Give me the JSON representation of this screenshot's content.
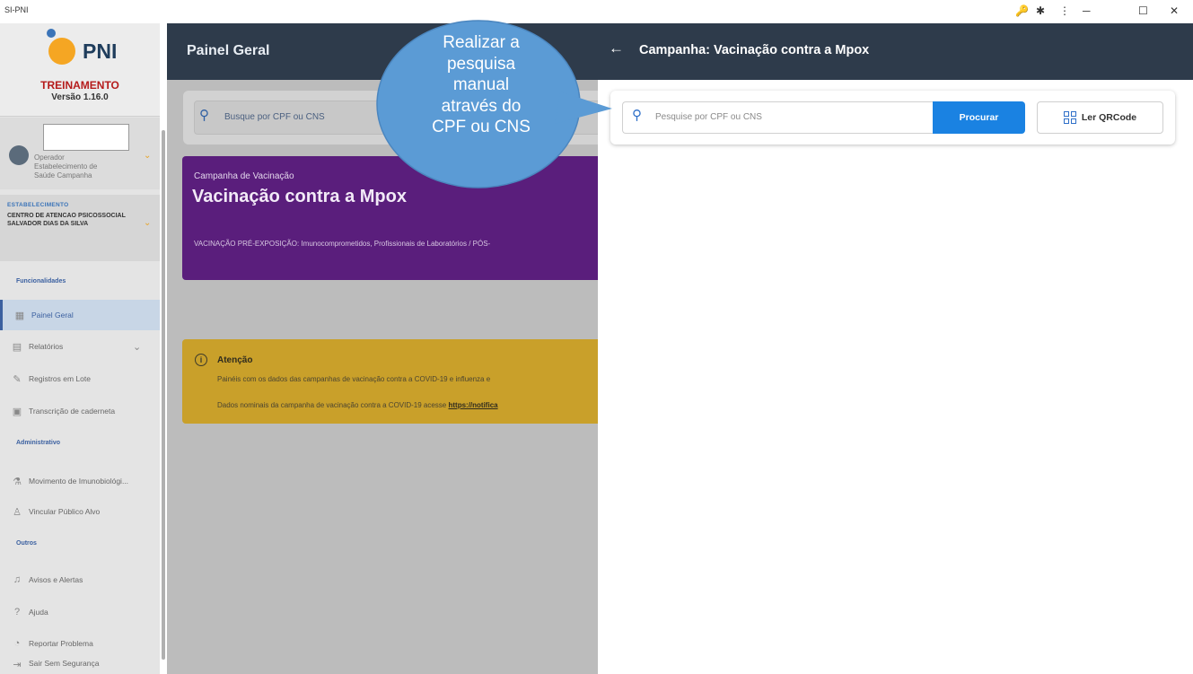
{
  "window": {
    "title": "SI-PNI",
    "controls": {
      "key": "🔑",
      "extension": "✱",
      "menu": "⋮",
      "minimize": "─",
      "maximize": "☐",
      "close": "✕"
    }
  },
  "sidebar": {
    "logo_text": "PNI",
    "environment": "TREINAMENTO",
    "version": "Versão 1.16.0",
    "user_role": "Operador\nEstabelecimento de\nSaúde Campanha",
    "estab_label": "ESTABELECIMENTO",
    "estab_name": "CENTRO DE ATENCAO PSICOSSOCIAL SALVADOR DIAS DA SILVA",
    "sections": {
      "funcionalidades": "Funcionalidades",
      "administrativo": "Administrativo",
      "outros": "Outros"
    },
    "items": [
      {
        "label": "Painel Geral",
        "icon": "dashboard-icon"
      },
      {
        "label": "Relatórios",
        "icon": "reports-icon"
      },
      {
        "label": "Registros em Lote",
        "icon": "syringe-icon"
      },
      {
        "label": "Transcrição de caderneta",
        "icon": "document-icon"
      },
      {
        "label": "Movimento de Imunobiológi...",
        "icon": "vaccine-icon"
      },
      {
        "label": "Vincular Público Alvo",
        "icon": "person-icon"
      },
      {
        "label": "Avisos e Alertas",
        "icon": "bell-icon"
      },
      {
        "label": "Ajuda",
        "icon": "help-icon"
      },
      {
        "label": "Reportar Problema",
        "icon": "report-icon"
      },
      {
        "label": "Sair Sem Segurança",
        "icon": "logout-icon"
      }
    ]
  },
  "main": {
    "header_title": "Painel Geral",
    "search_placeholder": "Busque por CPF ou CNS",
    "campaign_card": {
      "kicker": "Campanha de Vacinação",
      "title": "Vacinação contra a Mpox",
      "description": "VACINAÇÃO PRÉ-EXPOSIÇÃO: Imunocomprometidos, Profissionais de Laboratórios / PÓS-"
    },
    "attention_card": {
      "title": "Atenção",
      "line1": "Painéis com os dados das campanhas de vacinação contra a COVID-19 e influenza e ",
      "line2": "Dados nominais da campanha de vacinação contra a COVID-19 acesse ",
      "link": "https://notifica"
    }
  },
  "panel": {
    "title": "Campanha: Vacinação contra a Mpox",
    "search_placeholder": "Pesquise por CPF ou CNS",
    "search_button": "Procurar",
    "qr_button": "Ler QRCode"
  },
  "callout": {
    "lines": [
      "Realizar a",
      "pesquisa",
      "manual",
      "através do",
      "CPF ou CNS"
    ],
    "color": "#5b9bd5"
  },
  "colors": {
    "header": "#2e3b4b",
    "primary": "#1a82e2",
    "campaign": "#5a1e7c",
    "warning": "#c9a02a"
  }
}
